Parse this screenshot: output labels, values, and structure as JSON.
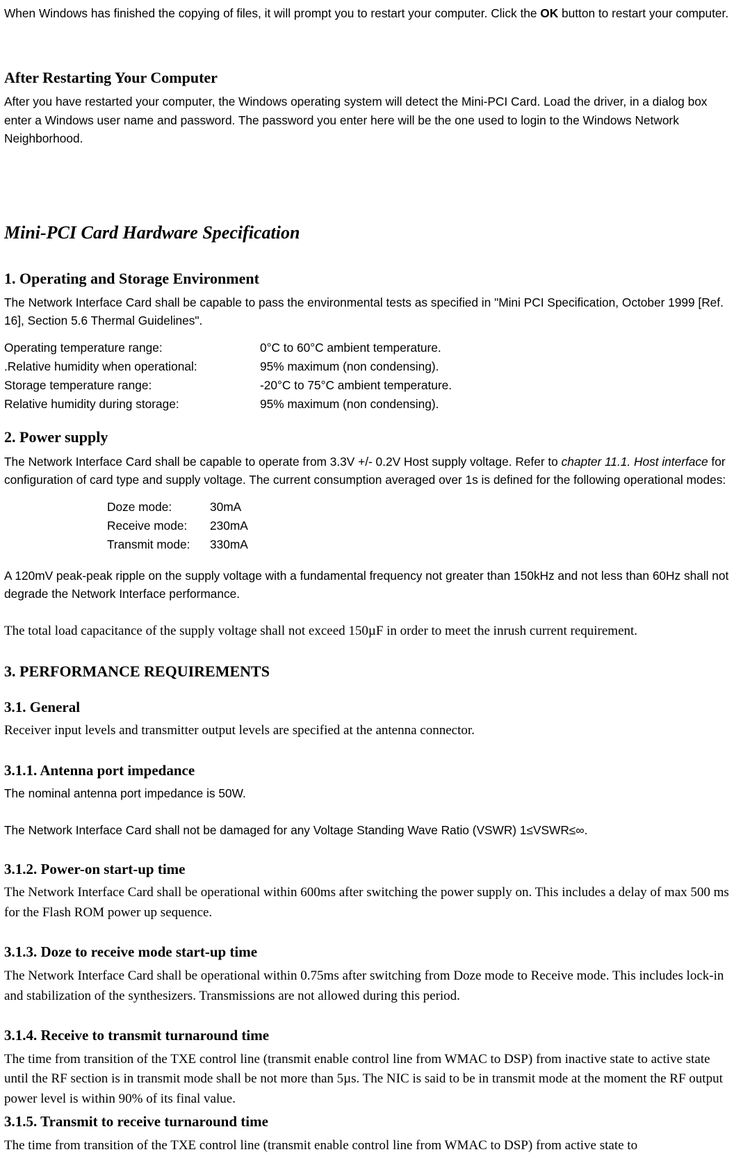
{
  "intro": {
    "p1_pre": "When Windows has finished the copying of files, it will prompt you to restart your computer.    Click the ",
    "p1_bold": "OK",
    "p1_post": " button to restart your computer."
  },
  "restart": {
    "heading": "After Restarting Your Computer",
    "p1": "After you have restarted your computer, the Windows operating system will detect the Mini-PCI Card.    Load the driver, in a dialog box enter a Windows user name and password.    The password you enter here will be the one used to login to the Windows Network Neighborhood."
  },
  "spec_title": "Mini-PCI Card Hardware Specification",
  "env": {
    "heading": "1. Operating and Storage Environment",
    "p1": "The Network Interface Card shall be capable to pass the environmental tests as specified in \"Mini PCI Specification, October 1999 [Ref. 16], Section 5.6 Thermal Guidelines\".",
    "rows": [
      {
        "label": "Operating temperature range:",
        "value": " 0°C to 60°C ambient temperature."
      },
      {
        "label": ".Relative humidity when operational:",
        "value": "95% maximum (non condensing)."
      },
      {
        "label": "Storage temperature range:",
        "value": " -20°C to 75°C ambient temperature."
      },
      {
        "label": "Relative humidity during storage:",
        "value": "95% maximum (non condensing)."
      }
    ]
  },
  "power": {
    "heading": "2. Power supply",
    "p1_pre": "The Network Interface Card shall be capable to operate from 3.3V +/- 0.2V Host supply voltage. Refer to ",
    "p1_italic": "chapter 11.1. Host interface ",
    "p1_post": "for configuration of card type and supply voltage. The current consumption averaged over 1s is defined for the following operational modes:",
    "modes": [
      {
        "label": "Doze mode:",
        "value": "  30mA"
      },
      {
        "label": "Receive mode:",
        "value": "230mA"
      },
      {
        "label": "Transmit mode:",
        "value": "330mA"
      }
    ],
    "p2": "A 120mV peak-peak ripple on the supply voltage with a fundamental frequency not greater than 150kHz and not less than 60Hz shall not degrade the Network Interface performance.",
    "p3": "The total load capacitance of the supply voltage shall not exceed 150µF in order to meet the inrush current requirement."
  },
  "perf": {
    "heading": "3. PERFORMANCE REQUIREMENTS",
    "general": {
      "heading": "3.1. General",
      "p1": "Receiver input levels and transmitter output levels are specified at the antenna connector."
    },
    "antenna": {
      "heading": "3.1.1. Antenna port impedance",
      "p1": "The nominal antenna port impedance is 50W.",
      "p2": "The Network Interface Card shall not be damaged for any Voltage Standing Wave Ratio (VSWR) 1≤VSWR≤∞."
    },
    "poweron": {
      "heading": "3.1.2. Power-on start-up time",
      "p1": "The Network Interface Card shall be operational within 600ms after switching the power supply on. This includes a delay of max 500 ms for the Flash ROM power up sequence."
    },
    "doze": {
      "heading": "3.1.3. Doze to receive mode start-up time",
      "p1": "The Network Interface Card shall be operational within 0.75ms after switching from Doze mode to Receive mode. This includes lock-in and stabilization of the synthesizers. Transmissions are not allowed during this period."
    },
    "rx2tx": {
      "heading": "3.1.4. Receive to transmit turnaround time",
      "p1": "The time from transition of the TXE control line (transmit enable control line from WMAC to DSP) from inactive state to active state until the RF section is in transmit mode shall be not more than 5µs. The NIC is said to be in transmit mode at the moment the RF output power level is within 90% of its final value."
    },
    "tx2rx": {
      "heading": "3.1.5. Transmit to receive turnaround time",
      "p1": "The time from transition of the TXE control line (transmit enable control line from WMAC to DSP) from active state to"
    }
  }
}
